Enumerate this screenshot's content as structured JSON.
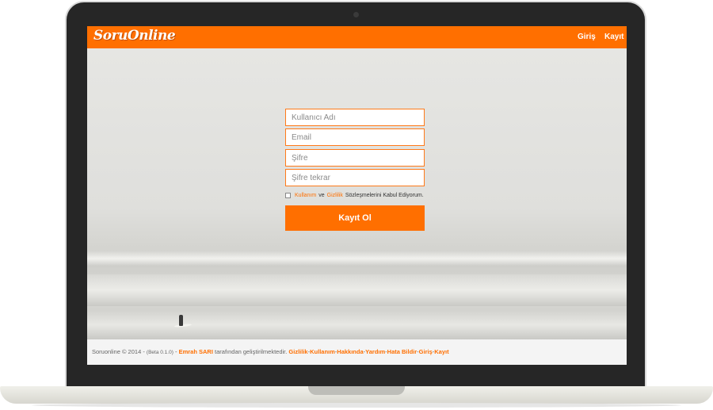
{
  "navbar": {
    "logo_text": "SoruOnline",
    "login_label": "Giriş",
    "register_label": "Kayıt"
  },
  "form": {
    "username_placeholder": "Kullanıcı Adı",
    "email_placeholder": "Email",
    "password_placeholder": "Şifre",
    "password_repeat_placeholder": "Şifre tekrar",
    "agree_terms_link": "Kullanım",
    "agree_and": "ve",
    "agree_privacy_link": "Gizlilik",
    "agree_suffix": "Sözleşmelerini Kabul Ediyorum.",
    "submit_label": "Kayıt Ol"
  },
  "footer": {
    "copyright": "Soruonline © 2014 -",
    "beta": "(Beta 0.1.0)",
    "dash": "-",
    "author": "Emrah SARI",
    "author_suffix": "tarafından geliştirilmektedir.",
    "links": [
      "Gizlilik",
      "Kullanım",
      "Hakkında",
      "Yardım",
      "Hata Bildir",
      "Giriş",
      "Kayıt"
    ],
    "separator": "-"
  },
  "colors": {
    "accent": "#ff6f00"
  }
}
